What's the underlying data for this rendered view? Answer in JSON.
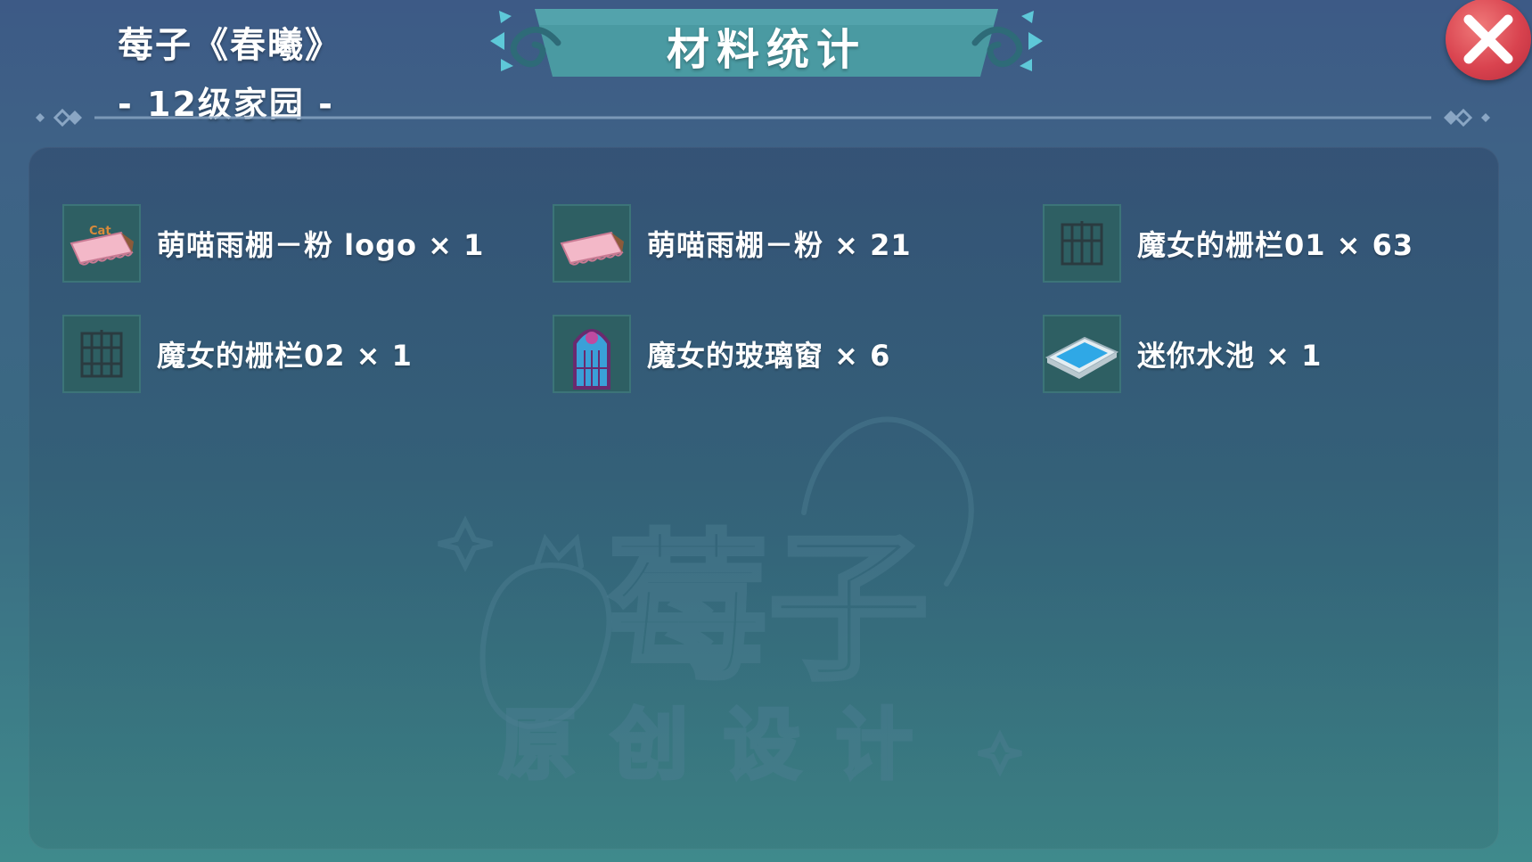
{
  "header": {
    "garden_name": "莓子《春曦》",
    "garden_level": "- 12级家园 -",
    "title": "材料统计"
  },
  "watermark": {
    "brand": "莓子",
    "tagline": "原创设计"
  },
  "items": [
    {
      "label": "萌喵雨棚－粉 logo × 1",
      "icon": "pink-awning-logo-icon"
    },
    {
      "label": "萌喵雨棚－粉 × 21",
      "icon": "pink-awning-icon"
    },
    {
      "label": "魔女的栅栏01 × 63",
      "icon": "witch-fence-icon"
    },
    {
      "label": "魔女的栅栏02 × 1",
      "icon": "witch-fence-icon"
    },
    {
      "label": "魔女的玻璃窗 × 6",
      "icon": "stained-glass-window-icon"
    },
    {
      "label": "迷你水池 × 1",
      "icon": "mini-pool-icon"
    }
  ],
  "colors": {
    "close_button": "#d9434f",
    "banner": "#4a9aa2",
    "accent": "#5ec8d8"
  }
}
